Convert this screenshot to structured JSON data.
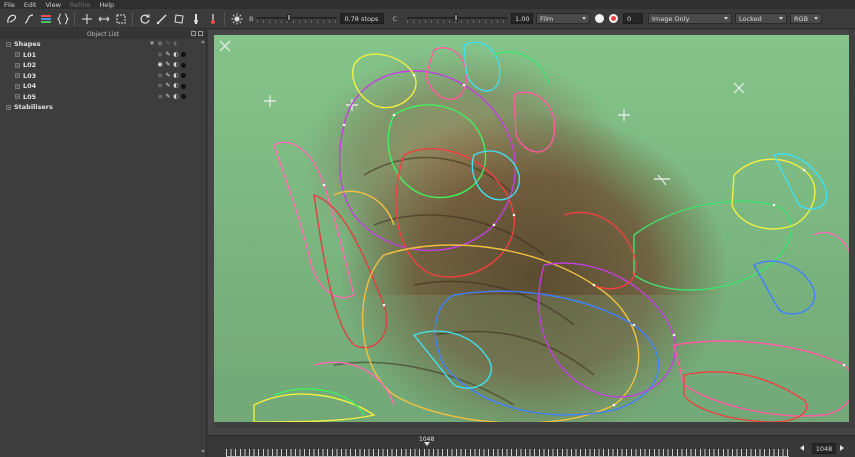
{
  "menu": [
    {
      "label": "File",
      "enabled": true
    },
    {
      "label": "Edit",
      "enabled": true
    },
    {
      "label": "View",
      "enabled": true
    },
    {
      "label": "Refine",
      "enabled": false
    },
    {
      "label": "Help",
      "enabled": true
    }
  ],
  "toolbar": {
    "tools": [
      "bspline-icon",
      "bezier-icon",
      "layers-icon",
      "braces-icon",
      "move-icon",
      "scale-icon",
      "select-icon",
      "rotate-icon",
      "pen-icon",
      "transform-icon",
      "brush-icon",
      "paint-icon"
    ],
    "exposure_label": "B",
    "exposure_value": "0.78 stops",
    "contrast_label": "C",
    "contrast_value": "1.00",
    "film_select": "Film",
    "number_value": "0",
    "display_select": "Image Only",
    "lock_select": "Locked",
    "color_select": "RGB"
  },
  "object_list": {
    "title": "Object List",
    "shapes_label": "Shapes",
    "layers": [
      "L01",
      "L02",
      "L03",
      "L04",
      "L05"
    ],
    "layer_visible": [
      false,
      true,
      false,
      false,
      false
    ],
    "stabilisers_label": "Stabilisers"
  },
  "timeline": {
    "current_frame_label": "1048",
    "frame_field": "1048"
  },
  "colors": {
    "background": "#3a3a3a",
    "panel": "#3d3d3d",
    "greenscreen": "#7ab57f"
  }
}
